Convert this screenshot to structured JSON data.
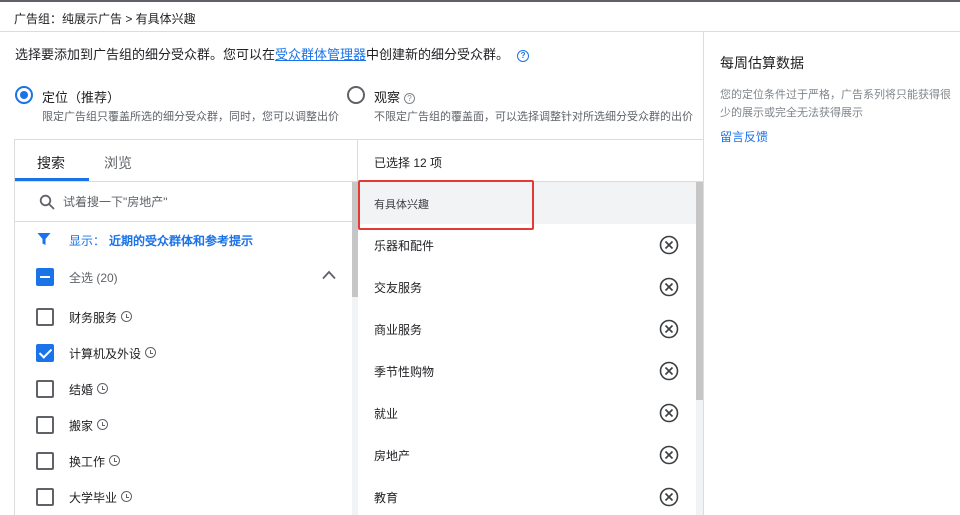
{
  "breadcrumb": "广告组：纯展示广告 > 有具体兴趣",
  "intro": {
    "prefix": "选择要添加到广告组的细分受众群。您可以在",
    "link": "受众群体管理器",
    "suffix": "中创建新的细分受众群。"
  },
  "targeting": [
    {
      "title": "定位（推荐）",
      "subtitle": "限定广告组只覆盖所选的细分受众群，同时，您可以调整出价"
    },
    {
      "title": "观察",
      "subtitle": "不限定广告组的覆盖面，可以选择调整针对所选细分受众群的出价"
    }
  ],
  "tabs": {
    "search": "搜索",
    "browse": "浏览"
  },
  "search": {
    "placeholder": "试着搜一下\"房地产\""
  },
  "filter": {
    "prefix": "显示：",
    "value": "近期的受众群体和参考提示"
  },
  "select_all": {
    "label": "全选 (20)"
  },
  "options": [
    {
      "label": "财务服务",
      "checked": false
    },
    {
      "label": "计算机及外设",
      "checked": true
    },
    {
      "label": "结婚",
      "checked": false
    },
    {
      "label": "搬家",
      "checked": false
    },
    {
      "label": "换工作",
      "checked": false
    },
    {
      "label": "大学毕业",
      "checked": false
    }
  ],
  "selected": {
    "count_label": "已选择 12 项",
    "group": "有具体兴趣",
    "items": [
      "乐器和配件",
      "交友服务",
      "商业服务",
      "季节性购物",
      "就业",
      "房地产",
      "教育"
    ]
  },
  "side": {
    "title": "每周估算数据",
    "text": "您的定位条件过于严格，广告系列将只能获得很少的展示或完全无法获得展示",
    "link": "留言反馈"
  },
  "colors": {
    "accent": "#1a73e8",
    "highlight": "#e53935"
  },
  "icons": [
    "help-icon",
    "search-icon",
    "filter-icon",
    "clock-icon",
    "chevron-up-icon",
    "remove-icon"
  ]
}
